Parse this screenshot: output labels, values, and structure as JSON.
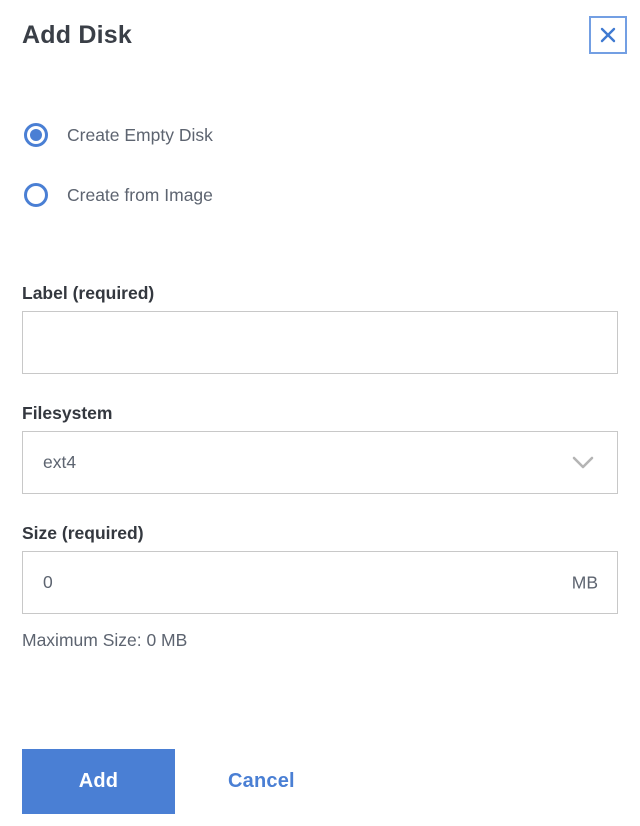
{
  "dialog": {
    "title": "Add Disk"
  },
  "radio_options": [
    {
      "label": "Create Empty Disk",
      "selected": true
    },
    {
      "label": "Create from Image",
      "selected": false
    }
  ],
  "fields": {
    "label": {
      "label": "Label (required)",
      "value": "",
      "placeholder": ""
    },
    "filesystem": {
      "label": "Filesystem",
      "value": "ext4"
    },
    "size": {
      "label": "Size (required)",
      "value": "0",
      "unit": "MB",
      "helper": "Maximum Size: 0 MB"
    }
  },
  "actions": {
    "add": "Add",
    "cancel": "Cancel"
  },
  "icons": {
    "close": "close-icon",
    "chevron": "chevron-down-icon"
  },
  "colors": {
    "primary_blue": "#4a7fd4",
    "close_border_blue": "#739fe3",
    "label_dark": "#34383f",
    "body_gray": "#5d6470",
    "input_border": "#c8c8c8",
    "chevron_gray": "#b4b4b4"
  }
}
